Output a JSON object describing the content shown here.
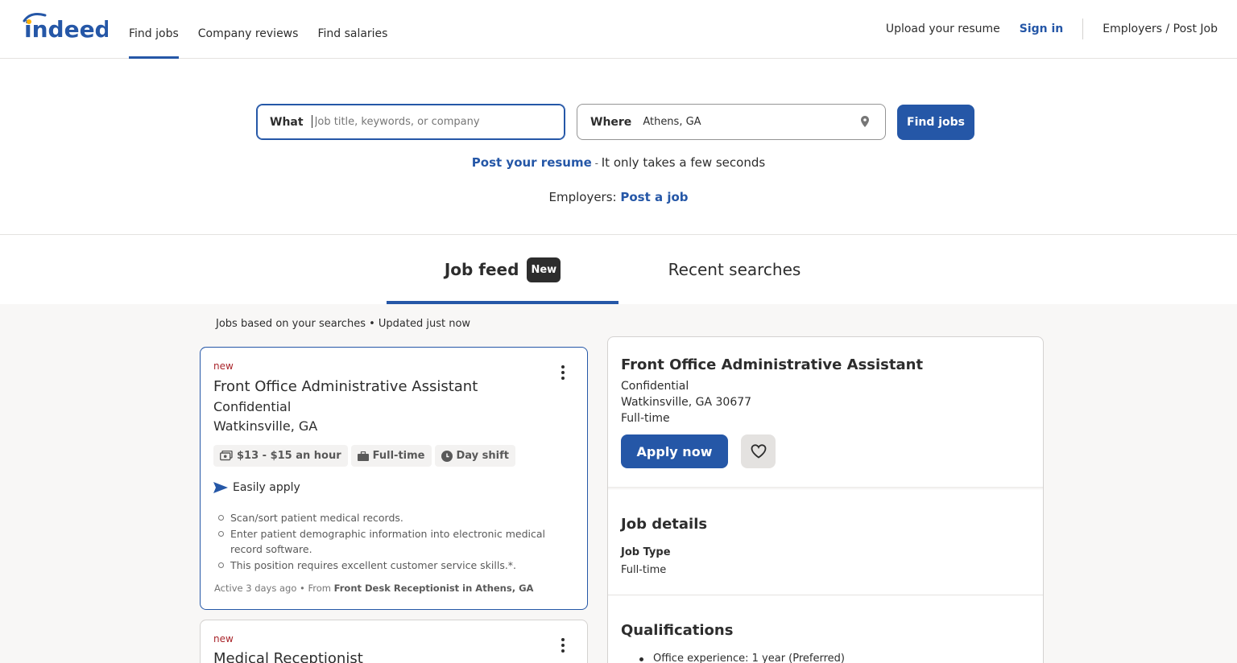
{
  "header": {
    "logo_text": "indeed",
    "nav": [
      "Find jobs",
      "Company reviews",
      "Find salaries"
    ],
    "upload": "Upload your resume",
    "signin": "Sign in",
    "employers": "Employers / Post Job"
  },
  "search": {
    "what_label": "What",
    "what_placeholder": "Job title, keywords, or company",
    "where_label": "Where",
    "where_value": "Athens, GA",
    "button": "Find jobs"
  },
  "promo": {
    "resume_link": "Post your resume",
    "resume_sep": " - ",
    "resume_text": "It only takes a few seconds",
    "employers_text": "Employers: ",
    "post_job_link": "Post a job"
  },
  "tabs": {
    "feed": "Job feed",
    "feed_badge": "New",
    "recent": "Recent searches"
  },
  "feed_meta": "Jobs based on your searches • Updated just now",
  "jobs": [
    {
      "badge": "new",
      "title": "Front Office Administrative Assistant",
      "company": "Confidential",
      "location": "Watkinsville, GA",
      "tags": [
        "$13 - $15 an hour",
        "Full-time",
        "Day shift"
      ],
      "easy_apply": "Easily apply",
      "bullets": [
        "Scan/sort patient medical records.",
        "Enter patient demographic information into electronic medical record software.",
        "This position requires excellent customer service skills.*."
      ],
      "footer_prefix": "Active 3 days ago • From ",
      "footer_bold": "Front Desk Receptionist in Athens, GA"
    },
    {
      "badge": "new",
      "title": "Medical Receptionist"
    }
  ],
  "detail": {
    "title": "Front Office Administrative Assistant",
    "company": "Confidential",
    "location": "Watkinsville, GA 30677",
    "type": "Full-time",
    "apply": "Apply now",
    "job_details_heading": "Job details",
    "job_type_label": "Job Type",
    "job_type_value": "Full-time",
    "qualifications_heading": "Qualifications",
    "qualification_1": "Office experience: 1 year (Preferred)"
  },
  "colors": {
    "brand_blue": "#2557a7",
    "logo_yellow": "#ffb100",
    "new_red": "#a9252b"
  }
}
